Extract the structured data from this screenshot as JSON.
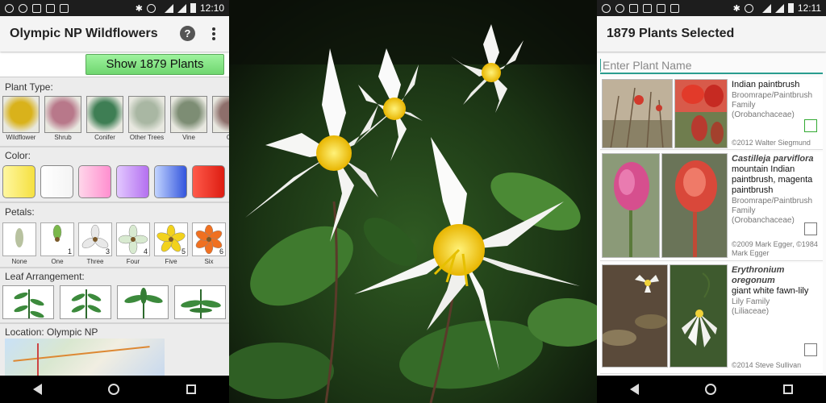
{
  "status": {
    "time_left": "12:10",
    "time_right": "12:11"
  },
  "left": {
    "title": "Olympic NP Wildflowers",
    "show_button": "Show 1879 Plants",
    "plant_type_label": "Plant Type:",
    "plant_types": [
      {
        "label": "Wildflower",
        "color": "#d9b21b"
      },
      {
        "label": "Shrub",
        "color": "#b8788a"
      },
      {
        "label": "Conifer",
        "color": "#3e7e54"
      },
      {
        "label": "Other Trees",
        "color": "#a9b7a3"
      },
      {
        "label": "Vine",
        "color": "#7d8d74"
      },
      {
        "label": "Ca",
        "color": "#8e6f6b"
      }
    ],
    "color_label": "Color:",
    "colors": [
      {
        "name": "yellow",
        "gradient": "linear-gradient(90deg,#fff7a0,#f5e040)"
      },
      {
        "name": "white",
        "gradient": "linear-gradient(90deg,#ffffff,#f4f4f4)"
      },
      {
        "name": "pink",
        "gradient": "linear-gradient(90deg,#ffd6ea,#ff8fcf)"
      },
      {
        "name": "purple",
        "gradient": "linear-gradient(90deg,#e2c8ff,#b470f0)"
      },
      {
        "name": "blue",
        "gradient": "linear-gradient(90deg,#c2d4ff,#3355dd)"
      },
      {
        "name": "red",
        "gradient": "linear-gradient(90deg,#ff5a4a,#dd1d12)"
      }
    ],
    "petals_label": "Petals:",
    "petals": [
      {
        "label": "None",
        "num": ""
      },
      {
        "label": "One",
        "num": "1"
      },
      {
        "label": "Three",
        "num": "3"
      },
      {
        "label": "Four",
        "num": "4"
      },
      {
        "label": "Five",
        "num": "5"
      },
      {
        "label": "Six",
        "num": "6"
      }
    ],
    "leaf_label": "Leaf Arrangement:",
    "location_label": "Location: Olympic NP"
  },
  "right": {
    "title": "1879 Plants Selected",
    "search_placeholder": "Enter Plant Name",
    "plants": [
      {
        "scientific": "",
        "common": "Indian paintbrush",
        "family": "Broomrape/Paintbrush Family",
        "family_latin": "(Orobanchaceae)",
        "credit": "©2012 Walter Siegmund",
        "checked_color": "#33aa33"
      },
      {
        "scientific": "Castilleja parviflora",
        "common": "mountain Indian paintbrush, magenta paintbrush",
        "family": "Broomrape/Paintbrush Family",
        "family_latin": "(Orobanchaceae)",
        "credit": "©2009 Mark Egger, ©1984 Mark Egger",
        "checked_color": "#666666"
      },
      {
        "scientific": "Erythronium oregonum",
        "common": "giant white fawn-lily",
        "family": "Lily Family",
        "family_latin": "(Liliaceae)",
        "credit": "©2014 Steve Sullivan",
        "checked_color": "#666666"
      }
    ]
  }
}
